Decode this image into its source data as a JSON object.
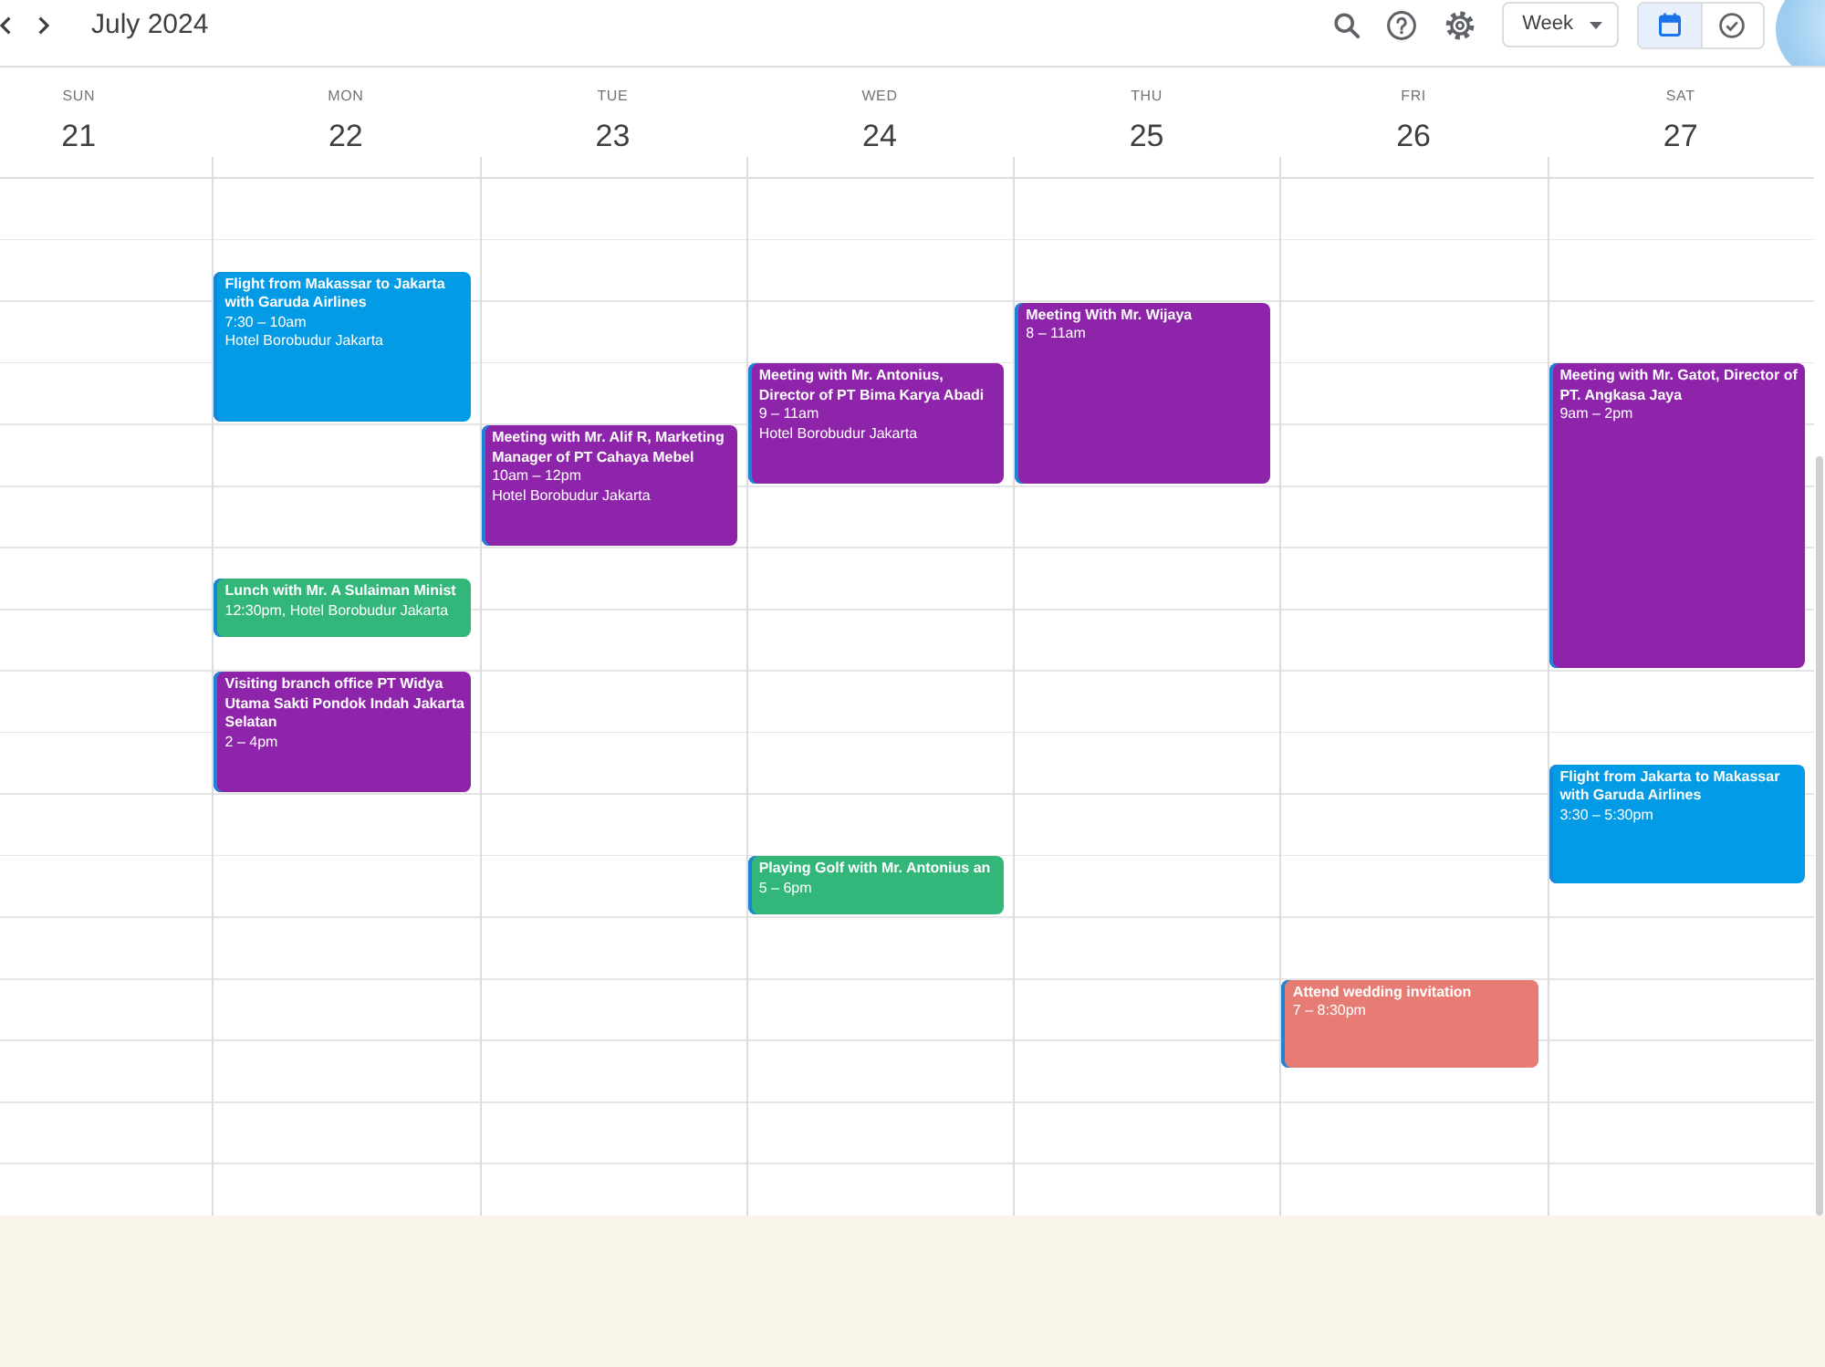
{
  "toolbar": {
    "title": "July 2024",
    "view": "Week",
    "views": [
      {
        "kind": "calendar",
        "selected": true
      },
      {
        "kind": "tasks",
        "selected": false
      }
    ]
  },
  "days": [
    {
      "weekday": "SUN",
      "date": "21"
    },
    {
      "weekday": "MON",
      "date": "22",
      "events": [
        {
          "title": "Flight from Makassar to Jakarta with Garuda Airlines",
          "time": "7:30 – 10am",
          "location": "Hotel Borobudur Jakarta",
          "color": "#039be5"
        },
        {
          "title": "Lunch with Mr. A Sulaiman Minist",
          "time": "12:30pm, Hotel Borobudur Jakarta",
          "color": "#33b679"
        },
        {
          "title": "Visiting branch office PT Widya Utama Sakti Pondok Indah Jakarta Selatan",
          "time": "2 – 4pm",
          "color": "#8e24aa"
        }
      ]
    },
    {
      "weekday": "TUE",
      "date": "23",
      "events": [
        {
          "title": "Meeting with Mr. Alif R, Marketing Manager of PT Cahaya Mebel",
          "time": "10am – 12pm",
          "location": "Hotel Borobudur Jakarta",
          "color": "#8e24aa"
        }
      ]
    },
    {
      "weekday": "WED",
      "date": "24",
      "events": [
        {
          "title": "Meeting with Mr. Antonius, Director of PT Bima Karya Abadi",
          "time": "9 – 11am",
          "location": "Hotel Borobudur Jakarta",
          "color": "#8e24aa"
        },
        {
          "title": "Playing Golf with Mr. Antonius an",
          "time": "5 – 6pm",
          "color": "#33b679"
        }
      ]
    },
    {
      "weekday": "THU",
      "date": "25",
      "events": [
        {
          "title": "Meeting With Mr. Wijaya",
          "time": "8 – 11am",
          "color": "#8e24aa"
        }
      ]
    },
    {
      "weekday": "FRI",
      "date": "26",
      "events": [
        {
          "title": "Attend wedding invitation",
          "time": "7 – 8:30pm",
          "color": "#e67c73"
        }
      ]
    },
    {
      "weekday": "SAT",
      "date": "27",
      "events": [
        {
          "title": "Meeting with Mr. Gatot, Director of PT. Angkasa Jaya",
          "time": "9am – 2pm",
          "color": "#8e24aa"
        },
        {
          "title": "Flight from Jakarta to Makassar with Garuda Airlines",
          "time": "3:30 – 5:30pm",
          "color": "#039be5"
        }
      ]
    }
  ]
}
